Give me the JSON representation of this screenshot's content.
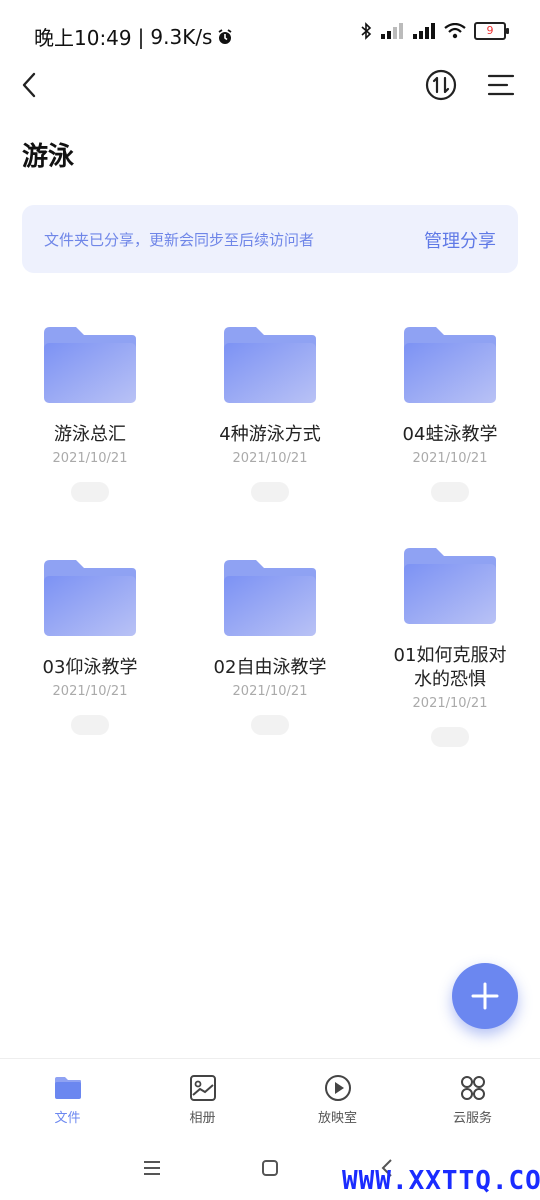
{
  "status": {
    "time": "晚上10:49",
    "speed": "9.3K/s",
    "battery": "9"
  },
  "header": {
    "title": "游泳"
  },
  "share": {
    "text": "文件夹已分享，更新会同步至后续访问者",
    "button": "管理分享"
  },
  "folders": [
    {
      "name": "游泳总汇",
      "date": "2021/10/21"
    },
    {
      "name": "4种游泳方式",
      "date": "2021/10/21"
    },
    {
      "name": "04蛙泳教学",
      "date": "2021/10/21"
    },
    {
      "name": "03仰泳教学",
      "date": "2021/10/21"
    },
    {
      "name": "02自由泳教学",
      "date": "2021/10/21"
    },
    {
      "name": "01如何克服对水的恐惧",
      "date": "2021/10/21"
    }
  ],
  "nav": [
    {
      "label": "文件",
      "icon": "folder-icon"
    },
    {
      "label": "相册",
      "icon": "album-icon"
    },
    {
      "label": "放映室",
      "icon": "play-icon"
    },
    {
      "label": "云服务",
      "icon": "grid-icon"
    }
  ],
  "watermark": "WWW.XXTTQ.COM",
  "colors": {
    "accent": "#6b87f0",
    "banner_bg": "#eef1fd"
  }
}
